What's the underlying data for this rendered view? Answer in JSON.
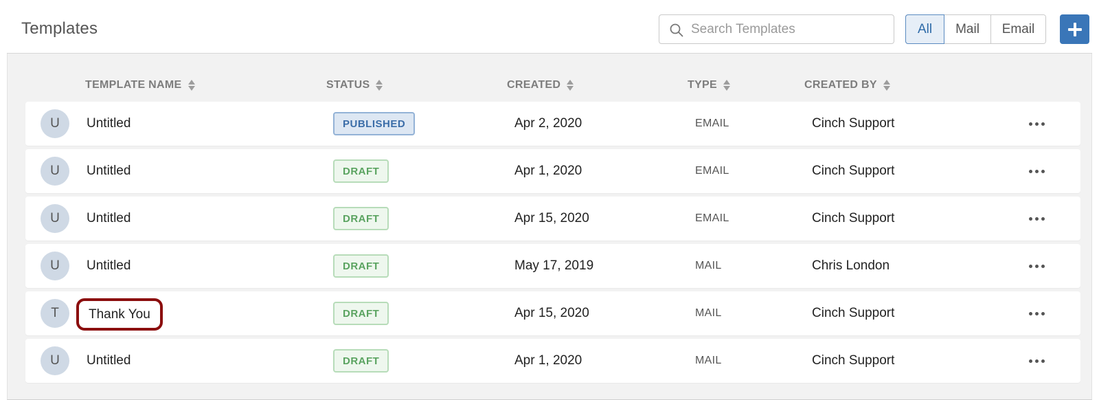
{
  "header": {
    "title": "Templates",
    "search_placeholder": "Search Templates",
    "filters": [
      {
        "label": "All",
        "active": true
      },
      {
        "label": "Mail",
        "active": false
      },
      {
        "label": "Email",
        "active": false
      }
    ],
    "add_icon": "plus-icon"
  },
  "table": {
    "columns": [
      "TEMPLATE NAME",
      "STATUS",
      "CREATED",
      "TYPE",
      "CREATED BY"
    ],
    "rows": [
      {
        "initial": "U",
        "name": "Untitled",
        "status": "PUBLISHED",
        "created": "Apr 2, 2020",
        "type": "EMAIL",
        "created_by": "Cinch Support"
      },
      {
        "initial": "U",
        "name": "Untitled",
        "status": "DRAFT",
        "created": "Apr 1, 2020",
        "type": "EMAIL",
        "created_by": "Cinch Support"
      },
      {
        "initial": "U",
        "name": "Untitled",
        "status": "DRAFT",
        "created": "Apr 15, 2020",
        "type": "EMAIL",
        "created_by": "Cinch Support"
      },
      {
        "initial": "U",
        "name": "Untitled",
        "status": "DRAFT",
        "created": "May 17, 2019",
        "type": "MAIL",
        "created_by": "Chris London"
      },
      {
        "initial": "T",
        "name": "Thank You",
        "status": "DRAFT",
        "created": "Apr 15, 2020",
        "type": "MAIL",
        "created_by": "Cinch Support",
        "highlighted": true
      },
      {
        "initial": "U",
        "name": "Untitled",
        "status": "DRAFT",
        "created": "Apr 1, 2020",
        "type": "MAIL",
        "created_by": "Cinch Support"
      }
    ]
  },
  "colors": {
    "accent": "#3a76b8",
    "published": "#3b6da8",
    "draft": "#5aa360",
    "highlight_outline": "#8b0d0d"
  }
}
